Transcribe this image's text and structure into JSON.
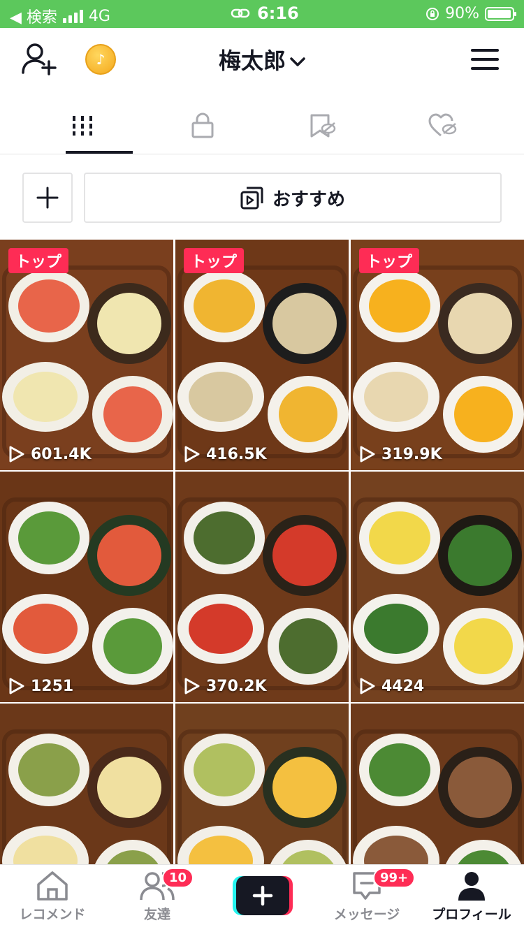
{
  "status_bar": {
    "back_label": "◀ 検索",
    "network": "4G",
    "time": "6:16",
    "battery": "90%"
  },
  "header": {
    "username": "梅太郎",
    "coin_glyph": "♪"
  },
  "tabs": [
    {
      "icon": "grid-icon",
      "active": true
    },
    {
      "icon": "lock-icon",
      "active": false
    },
    {
      "icon": "bookmark-hidden-icon",
      "active": false
    },
    {
      "icon": "heart-hidden-icon",
      "active": false
    }
  ],
  "actions": {
    "add_label": "+",
    "recommend_label": "おすすめ"
  },
  "videos": [
    {
      "views": "601.4K",
      "badge": "トップ"
    },
    {
      "views": "416.5K",
      "badge": "トップ"
    },
    {
      "views": "319.9K",
      "badge": "トップ"
    },
    {
      "views": "1251"
    },
    {
      "views": "370.2K"
    },
    {
      "views": "4424"
    },
    {
      "views": ""
    },
    {
      "views": ""
    },
    {
      "views": ""
    }
  ],
  "bottom_nav": {
    "home": "レコメンド",
    "friends": "友達",
    "friends_badge": "10",
    "messages": "メッセージ",
    "messages_badge": "99+",
    "profile": "プロフィール"
  },
  "colors": {
    "status_bar": "#5cc85c",
    "accent": "#fe2c55",
    "text": "#161823"
  }
}
